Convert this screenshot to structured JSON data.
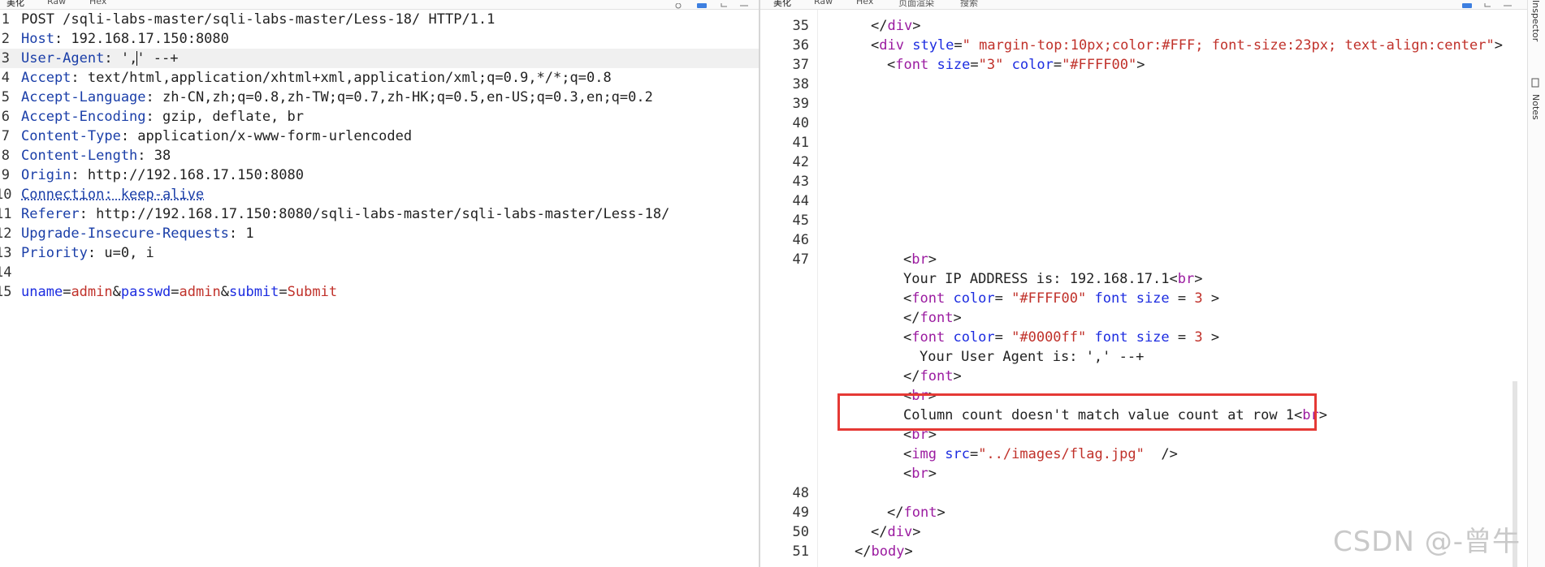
{
  "request_pane": {
    "tabs": [
      "美化",
      "Raw",
      "Hex"
    ],
    "lines": [
      {
        "n": "1",
        "segments": [
          {
            "t": "POST /sqli-labs-master/sqli-labs-master/Less-18/ HTTP/1.1"
          }
        ]
      },
      {
        "n": "2",
        "segments": [
          {
            "t": "Host",
            "c": "hk"
          },
          {
            "t": ": 192.168.17.150:8080"
          }
        ]
      },
      {
        "n": "3",
        "highlight": true,
        "segments": [
          {
            "t": "User-Agent",
            "c": "hk"
          },
          {
            "t": ": ',"
          },
          {
            "t": "",
            "caret": true
          },
          {
            "t": "' --+"
          }
        ]
      },
      {
        "n": "4",
        "segments": [
          {
            "t": "Accept",
            "c": "hk"
          },
          {
            "t": ": text/html,application/xhtml+xml,application/xml;q=0.9,*/*;q=0.8"
          }
        ]
      },
      {
        "n": "5",
        "segments": [
          {
            "t": "Accept-Language",
            "c": "hk"
          },
          {
            "t": ": zh-CN,zh;q=0.8,zh-TW;q=0.7,zh-HK;q=0.5,en-US;q=0.3,en;q=0.2"
          }
        ]
      },
      {
        "n": "6",
        "segments": [
          {
            "t": "Accept-Encoding",
            "c": "hk"
          },
          {
            "t": ": gzip, deflate, br"
          }
        ]
      },
      {
        "n": "7",
        "segments": [
          {
            "t": "Content-Type",
            "c": "hk"
          },
          {
            "t": ": application/x-www-form-urlencoded"
          }
        ]
      },
      {
        "n": "8",
        "segments": [
          {
            "t": "Content-Length",
            "c": "hk"
          },
          {
            "t": ": 38"
          }
        ]
      },
      {
        "n": "9",
        "segments": [
          {
            "t": "Origin",
            "c": "hk"
          },
          {
            "t": ": http://192.168.17.150:8080"
          }
        ]
      },
      {
        "n": "10",
        "segments": [
          {
            "t": "Connection: keep-alive",
            "c": "hk ul"
          }
        ]
      },
      {
        "n": "11",
        "segments": [
          {
            "t": "Referer",
            "c": "hk"
          },
          {
            "t": ": http://192.168.17.150:8080/sqli-labs-master/sqli-labs-master/Less-18/"
          }
        ]
      },
      {
        "n": "12",
        "segments": [
          {
            "t": "Upgrade-Insecure-Requests",
            "c": "hk"
          },
          {
            "t": ": 1"
          }
        ]
      },
      {
        "n": "13",
        "segments": [
          {
            "t": "Priority",
            "c": "hk"
          },
          {
            "t": ": u=0, i"
          }
        ]
      },
      {
        "n": "14",
        "segments": []
      },
      {
        "n": "15",
        "segments": [
          {
            "t": "uname",
            "c": "at"
          },
          {
            "t": "="
          },
          {
            "t": "admin",
            "c": "av"
          },
          {
            "t": "&"
          },
          {
            "t": "passwd",
            "c": "at"
          },
          {
            "t": "="
          },
          {
            "t": "admin",
            "c": "av"
          },
          {
            "t": "&"
          },
          {
            "t": "submit",
            "c": "at"
          },
          {
            "t": "="
          },
          {
            "t": "Submit",
            "c": "av"
          }
        ]
      }
    ]
  },
  "response_pane": {
    "tabs": [
      "美化",
      "Raw",
      "Hex",
      "页面渲染",
      "搜索"
    ],
    "lines": [
      {
        "n": "35",
        "indent": 3,
        "segments": [
          {
            "t": "</"
          },
          {
            "t": "div",
            "c": "tg"
          },
          {
            "t": ">"
          }
        ]
      },
      {
        "n": "36",
        "indent": 3,
        "segments": [
          {
            "t": "<"
          },
          {
            "t": "div",
            "c": "tg"
          },
          {
            "t": " "
          },
          {
            "t": "style",
            "c": "at"
          },
          {
            "t": "="
          },
          {
            "t": "\" margin-top:10px;color:#FFF; font-size:23px; text-align:center\"",
            "c": "av"
          },
          {
            "t": ">"
          }
        ]
      },
      {
        "n": "37",
        "indent": 4,
        "segments": [
          {
            "t": "<"
          },
          {
            "t": "font",
            "c": "tg"
          },
          {
            "t": " "
          },
          {
            "t": "size",
            "c": "at"
          },
          {
            "t": "="
          },
          {
            "t": "\"3\"",
            "c": "av"
          },
          {
            "t": " "
          },
          {
            "t": "color",
            "c": "at"
          },
          {
            "t": "="
          },
          {
            "t": "\"#FFFF00\"",
            "c": "av"
          },
          {
            "t": ">"
          }
        ]
      },
      {
        "n": "38",
        "segments": []
      },
      {
        "n": "39",
        "segments": []
      },
      {
        "n": "40",
        "segments": []
      },
      {
        "n": "41",
        "segments": []
      },
      {
        "n": "42",
        "segments": []
      },
      {
        "n": "43",
        "segments": []
      },
      {
        "n": "44",
        "segments": []
      },
      {
        "n": "45",
        "segments": []
      },
      {
        "n": "46",
        "segments": []
      },
      {
        "n": "47",
        "indent": 5,
        "segments": [
          {
            "t": "<"
          },
          {
            "t": "br",
            "c": "tg"
          },
          {
            "t": ">"
          }
        ]
      },
      {
        "n": "",
        "indent": 5,
        "segments": [
          {
            "t": "Your IP ADDRESS is: 192.168.17.1"
          },
          {
            "t": "<"
          },
          {
            "t": "br",
            "c": "tg"
          },
          {
            "t": ">"
          }
        ]
      },
      {
        "n": "",
        "indent": 5,
        "segments": [
          {
            "t": "<"
          },
          {
            "t": "font",
            "c": "tg"
          },
          {
            "t": " "
          },
          {
            "t": "color",
            "c": "at"
          },
          {
            "t": "= "
          },
          {
            "t": "\"#FFFF00\"",
            "c": "av"
          },
          {
            "t": " "
          },
          {
            "t": "font",
            "c": "at"
          },
          {
            "t": " "
          },
          {
            "t": "size",
            "c": "at"
          },
          {
            "t": " = "
          },
          {
            "t": "3",
            "c": "av"
          },
          {
            "t": " >"
          }
        ]
      },
      {
        "n": "",
        "indent": 5,
        "segments": [
          {
            "t": "</"
          },
          {
            "t": "font",
            "c": "tg"
          },
          {
            "t": ">"
          }
        ]
      },
      {
        "n": "",
        "indent": 5,
        "segments": [
          {
            "t": "<"
          },
          {
            "t": "font",
            "c": "tg"
          },
          {
            "t": " "
          },
          {
            "t": "color",
            "c": "at"
          },
          {
            "t": "= "
          },
          {
            "t": "\"#0000ff\"",
            "c": "av"
          },
          {
            "t": " "
          },
          {
            "t": "font",
            "c": "at"
          },
          {
            "t": " "
          },
          {
            "t": "size",
            "c": "at"
          },
          {
            "t": " = "
          },
          {
            "t": "3",
            "c": "av"
          },
          {
            "t": " >"
          }
        ]
      },
      {
        "n": "",
        "indent": 6,
        "segments": [
          {
            "t": "Your User Agent is: ',' --+"
          }
        ]
      },
      {
        "n": "",
        "indent": 5,
        "segments": [
          {
            "t": "</"
          },
          {
            "t": "font",
            "c": "tg"
          },
          {
            "t": ">"
          }
        ]
      },
      {
        "n": "",
        "indent": 5,
        "segments": [
          {
            "t": "<"
          },
          {
            "t": "br",
            "c": "tg"
          },
          {
            "t": ">"
          }
        ]
      },
      {
        "n": "",
        "indent": 5,
        "segments": [
          {
            "t": "Column count doesn't match value count at row 1"
          },
          {
            "t": "<"
          },
          {
            "t": "br",
            "c": "tg"
          },
          {
            "t": ">"
          }
        ]
      },
      {
        "n": "",
        "indent": 5,
        "segments": [
          {
            "t": "<"
          },
          {
            "t": "br",
            "c": "tg"
          },
          {
            "t": ">"
          }
        ]
      },
      {
        "n": "",
        "indent": 5,
        "segments": [
          {
            "t": "<"
          },
          {
            "t": "img",
            "c": "tg"
          },
          {
            "t": " "
          },
          {
            "t": "src",
            "c": "at"
          },
          {
            "t": "="
          },
          {
            "t": "\"../images/flag.jpg\"",
            "c": "av"
          },
          {
            "t": "  />"
          }
        ]
      },
      {
        "n": "",
        "indent": 5,
        "segments": [
          {
            "t": "<"
          },
          {
            "t": "br",
            "c": "tg"
          },
          {
            "t": ">"
          }
        ]
      },
      {
        "n": "48",
        "segments": []
      },
      {
        "n": "49",
        "indent": 4,
        "segments": [
          {
            "t": "</"
          },
          {
            "t": "font",
            "c": "tg"
          },
          {
            "t": ">"
          }
        ]
      },
      {
        "n": "50",
        "indent": 3,
        "segments": [
          {
            "t": "</"
          },
          {
            "t": "div",
            "c": "tg"
          },
          {
            "t": ">"
          }
        ]
      },
      {
        "n": "51",
        "indent": 2,
        "segments": [
          {
            "t": "</"
          },
          {
            "t": "body",
            "c": "tg"
          },
          {
            "t": ">"
          }
        ]
      }
    ]
  },
  "side_panel": {
    "items": [
      "Inspector",
      "Notes"
    ]
  },
  "watermark": "CSDN @-曾牛",
  "colors": {
    "highlight_box": "#e53935",
    "header_key": "#1a3ea8",
    "tag": "#9b1ba0",
    "attr": "#1c2ce0",
    "value": "#c0312a"
  }
}
